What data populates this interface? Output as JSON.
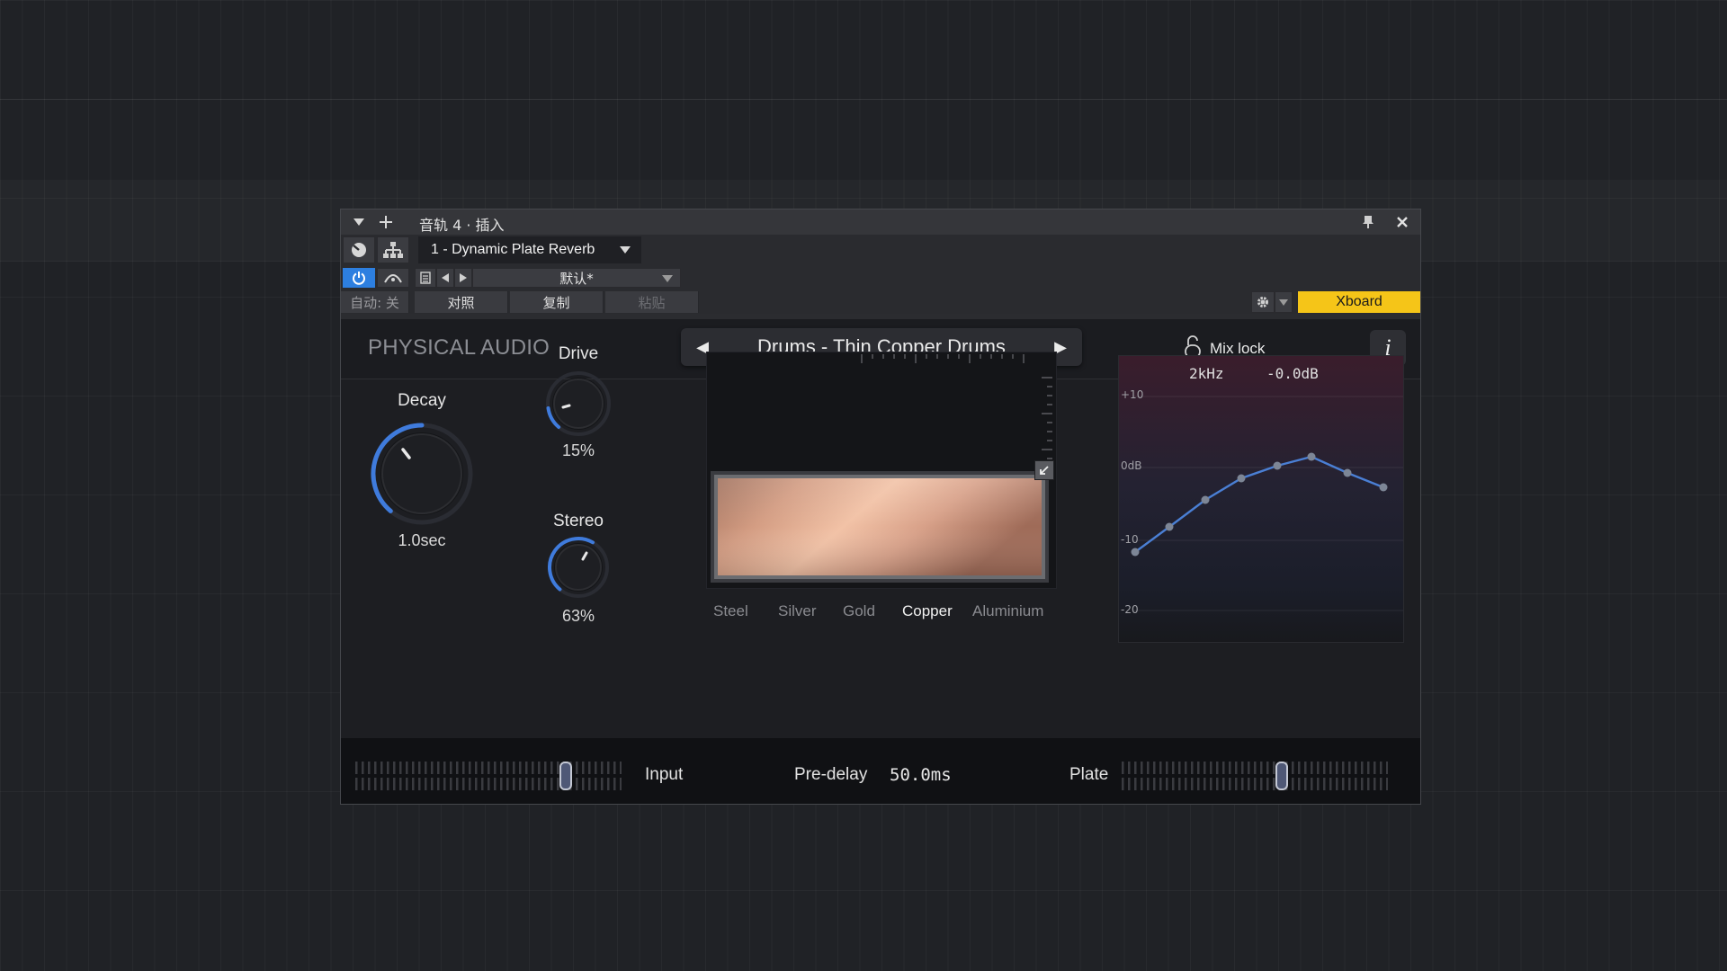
{
  "host": {
    "title": "音轨 4 · 插入",
    "plugin_selector": "1 - Dynamic Plate Reverb",
    "preset_selector": "默认*",
    "auto_label": "自动: 关",
    "compare_label": "对照",
    "copy_label": "复制",
    "paste_label": "粘贴",
    "xboard_label": "Xboard"
  },
  "plugin": {
    "brand": "PHYSICAL AUDIO",
    "preset_name": "Drums - Thin Copper Drums",
    "mix_lock_label": "Mix lock",
    "info_label": "i",
    "knobs": {
      "decay": {
        "label": "Decay",
        "value": "1.0sec"
      },
      "drive": {
        "label": "Drive",
        "value": "15%"
      },
      "stereo": {
        "label": "Stereo",
        "value": "63%"
      }
    },
    "materials": [
      {
        "label": "Steel",
        "active": false
      },
      {
        "label": "Silver",
        "active": false
      },
      {
        "label": "Gold",
        "active": false
      },
      {
        "label": "Copper",
        "active": true
      },
      {
        "label": "Aluminium",
        "active": false
      }
    ],
    "eq": {
      "freq_readout": "2kHz",
      "gain_readout": "-0.0dB",
      "db_labels": [
        "+10",
        "0dB",
        "-10",
        "-20"
      ]
    },
    "bottom": {
      "input_label": "Input",
      "predelay_label": "Pre-delay",
      "predelay_value": "50.0ms",
      "plate_label": "Plate"
    }
  },
  "colors": {
    "accent_blue": "#3f7bdc",
    "xboard_yellow": "#f5c518",
    "copper_light": "#f2c2a6"
  }
}
